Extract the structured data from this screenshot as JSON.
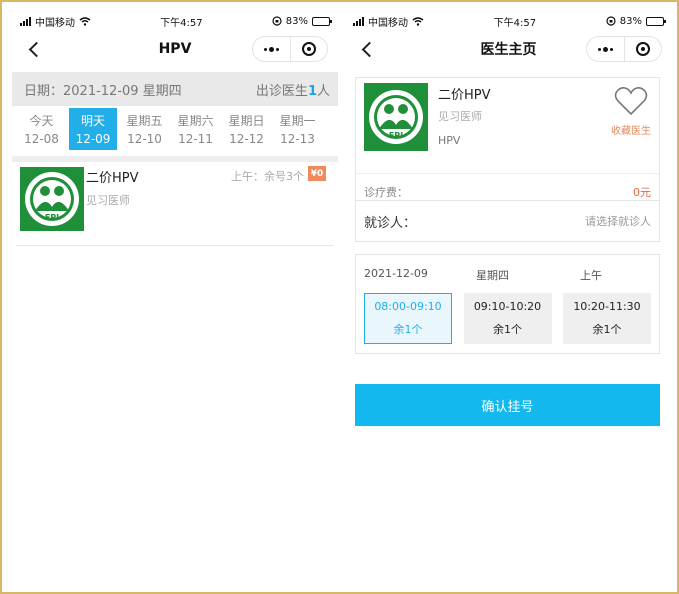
{
  "colors": {
    "accent": "#22aee8",
    "button": "#12b8ee",
    "fee_badge": "#f08a5d",
    "favorite": "#e58a5e",
    "frame_border": "#d7b865"
  },
  "status_bar": {
    "carrier": "中国移动",
    "time": "下午4:57",
    "battery": "83%",
    "battery_level": 0.83
  },
  "left_screen": {
    "nav_title": "HPV",
    "date_bar": {
      "date_text": "日期：2021-12-09 星期四",
      "doctor_prefix": "出诊医生",
      "doctor_count": "1",
      "doctor_suffix": "人"
    },
    "days": [
      {
        "label": "今天",
        "date": "12-08"
      },
      {
        "label": "明天",
        "date": "12-09"
      },
      {
        "label": "星期五",
        "date": "12-10"
      },
      {
        "label": "星期六",
        "date": "12-11"
      },
      {
        "label": "星期日",
        "date": "12-12"
      },
      {
        "label": "星期一",
        "date": "12-13"
      }
    ],
    "selected_day_index": 1,
    "doctor": {
      "name": "二价HPV",
      "title": "见习医师",
      "slot": "上午：余号3个",
      "fee_badge": "¥0",
      "logo_text": "EPI"
    }
  },
  "right_screen": {
    "nav_title": "医生主页",
    "doctor": {
      "name": "二价HPV",
      "title": "见习医师",
      "dept": "HPV",
      "favorite_label": "收藏医生",
      "logo_text": "EPI"
    },
    "fee": {
      "label": "诊疗费：",
      "value": "0元"
    },
    "patient": {
      "label": "就诊人：",
      "placeholder": "请选择就诊人"
    },
    "schedule": {
      "date": "2021-12-09",
      "weekday": "星期四",
      "period": "上午",
      "slots": [
        {
          "time": "08:00-09:10",
          "remain": "余1个"
        },
        {
          "time": "09:10-10:20",
          "remain": "余1个"
        },
        {
          "time": "10:20-11:30",
          "remain": "余1个"
        }
      ],
      "selected_slot_index": 0
    },
    "confirm_label": "确认挂号"
  }
}
